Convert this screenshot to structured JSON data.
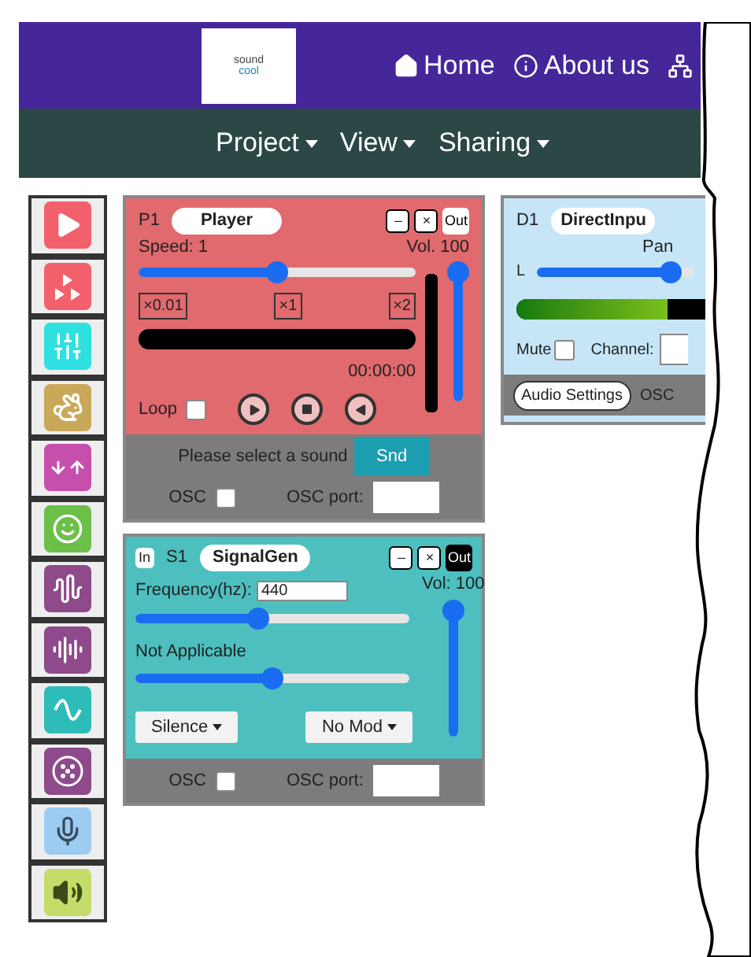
{
  "header": {
    "logo": {
      "top": "sound",
      "bottom": "cool"
    },
    "links": [
      {
        "kind": "home",
        "label": "Home"
      },
      {
        "kind": "info",
        "label": "About us"
      },
      {
        "kind": "network"
      }
    ]
  },
  "menus": [
    {
      "label": "Project"
    },
    {
      "label": "View"
    },
    {
      "label": "Sharing"
    }
  ],
  "toolbox": [
    {
      "kind": "play",
      "color": "#f2616b"
    },
    {
      "kind": "multiplay",
      "color": "#f2616b"
    },
    {
      "kind": "mixer",
      "color": "#2ee0e0"
    },
    {
      "kind": "turtle",
      "color": "#c9a85a"
    },
    {
      "kind": "arrows",
      "color": "#c64fae"
    },
    {
      "kind": "face",
      "color": "#6cc04a"
    },
    {
      "kind": "wave",
      "color": "#8e4a8a"
    },
    {
      "kind": "wave2",
      "color": "#8e4a8a"
    },
    {
      "kind": "sine",
      "color": "#2ebcb8"
    },
    {
      "kind": "dots",
      "color": "#8e4a8a"
    },
    {
      "kind": "mic",
      "color": "#9cccf2"
    },
    {
      "kind": "speaker",
      "color": "#c3dc6a"
    }
  ],
  "player": {
    "id": "P1",
    "name": "Player",
    "minimize": "–",
    "close": "×",
    "out": {
      "label": "Out",
      "active": false
    },
    "speed": {
      "label": "Speed: 1",
      "level": 0.5
    },
    "volume": {
      "label": "Vol. 100",
      "level": 1
    },
    "marks": [
      "×0.01",
      "×1",
      "×2"
    ],
    "time": "00:00:00",
    "loop": {
      "label": "Loop",
      "checked": false
    },
    "message": "Please select a sound",
    "sound_button": "Snd",
    "osc": {
      "label": "OSC",
      "checked": false
    },
    "osc_port": "OSC port:"
  },
  "signal_gen": {
    "in": "In",
    "id": "S1",
    "name": "SignalGen",
    "minimize": "–",
    "close": "×",
    "out": {
      "label": "Out",
      "active": true
    },
    "frequency": {
      "label": "Frequency(hz):",
      "value": "440",
      "level": 0.45
    },
    "modulation": {
      "label": "Not Applicable",
      "level": 0.5
    },
    "volume": {
      "label": "Vol: 100",
      "level": 1
    },
    "wave_menu": "Silence",
    "mod_menu": "No Mod",
    "osc": {
      "label": "OSC",
      "checked": false
    },
    "osc_port": "OSC port:"
  },
  "direct_input": {
    "id": "D1",
    "name": "DirectInpu",
    "pan": {
      "label": "Pan",
      "level": 0.85
    },
    "left_label": "L",
    "meter": {
      "level": 0.8
    },
    "mute": {
      "label": "Mute",
      "checked": false
    },
    "channel_label": "Channel:",
    "audio_settings": "Audio Settings",
    "osc_port": "OSC"
  }
}
